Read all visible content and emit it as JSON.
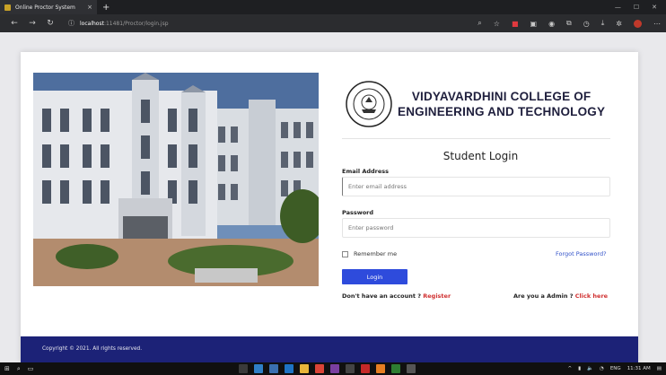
{
  "browser": {
    "tab_title": "Online Proctor System",
    "tab_close": "×",
    "new_tab": "+",
    "url_host": "localhost",
    "url_path": ":11481/Proctor/login.jsp"
  },
  "college": {
    "name_line1": "VIDYAVARDHINI COLLEGE OF",
    "name_line2": "ENGINEERING AND TECHNOLOGY",
    "seal_text_top": "VIDYAVARDHINI",
    "seal_text_center": "ज्ञानं परमं बलम्"
  },
  "login": {
    "title": "Student Login",
    "email_label": "Email Address",
    "email_placeholder": "Enter email address",
    "password_label": "Password",
    "password_placeholder": "Enter password",
    "remember_label": "Remember me",
    "forgot_link": "Forgot Password?",
    "button_label": "Login",
    "no_account_text": "Don't have an account ? ",
    "register_link": "Register",
    "admin_text": "Are you a Admin ? ",
    "admin_link": "Click here"
  },
  "footer": {
    "copyright": "Copyright © 2021. All rights reserved."
  },
  "taskbar": {
    "language": "ENG",
    "time": "11:31 AM"
  },
  "colors": {
    "accent": "#2e4bdc",
    "footer_bg": "#1c2277",
    "link_red": "#d03030",
    "forgot_blue": "#3050c8"
  }
}
